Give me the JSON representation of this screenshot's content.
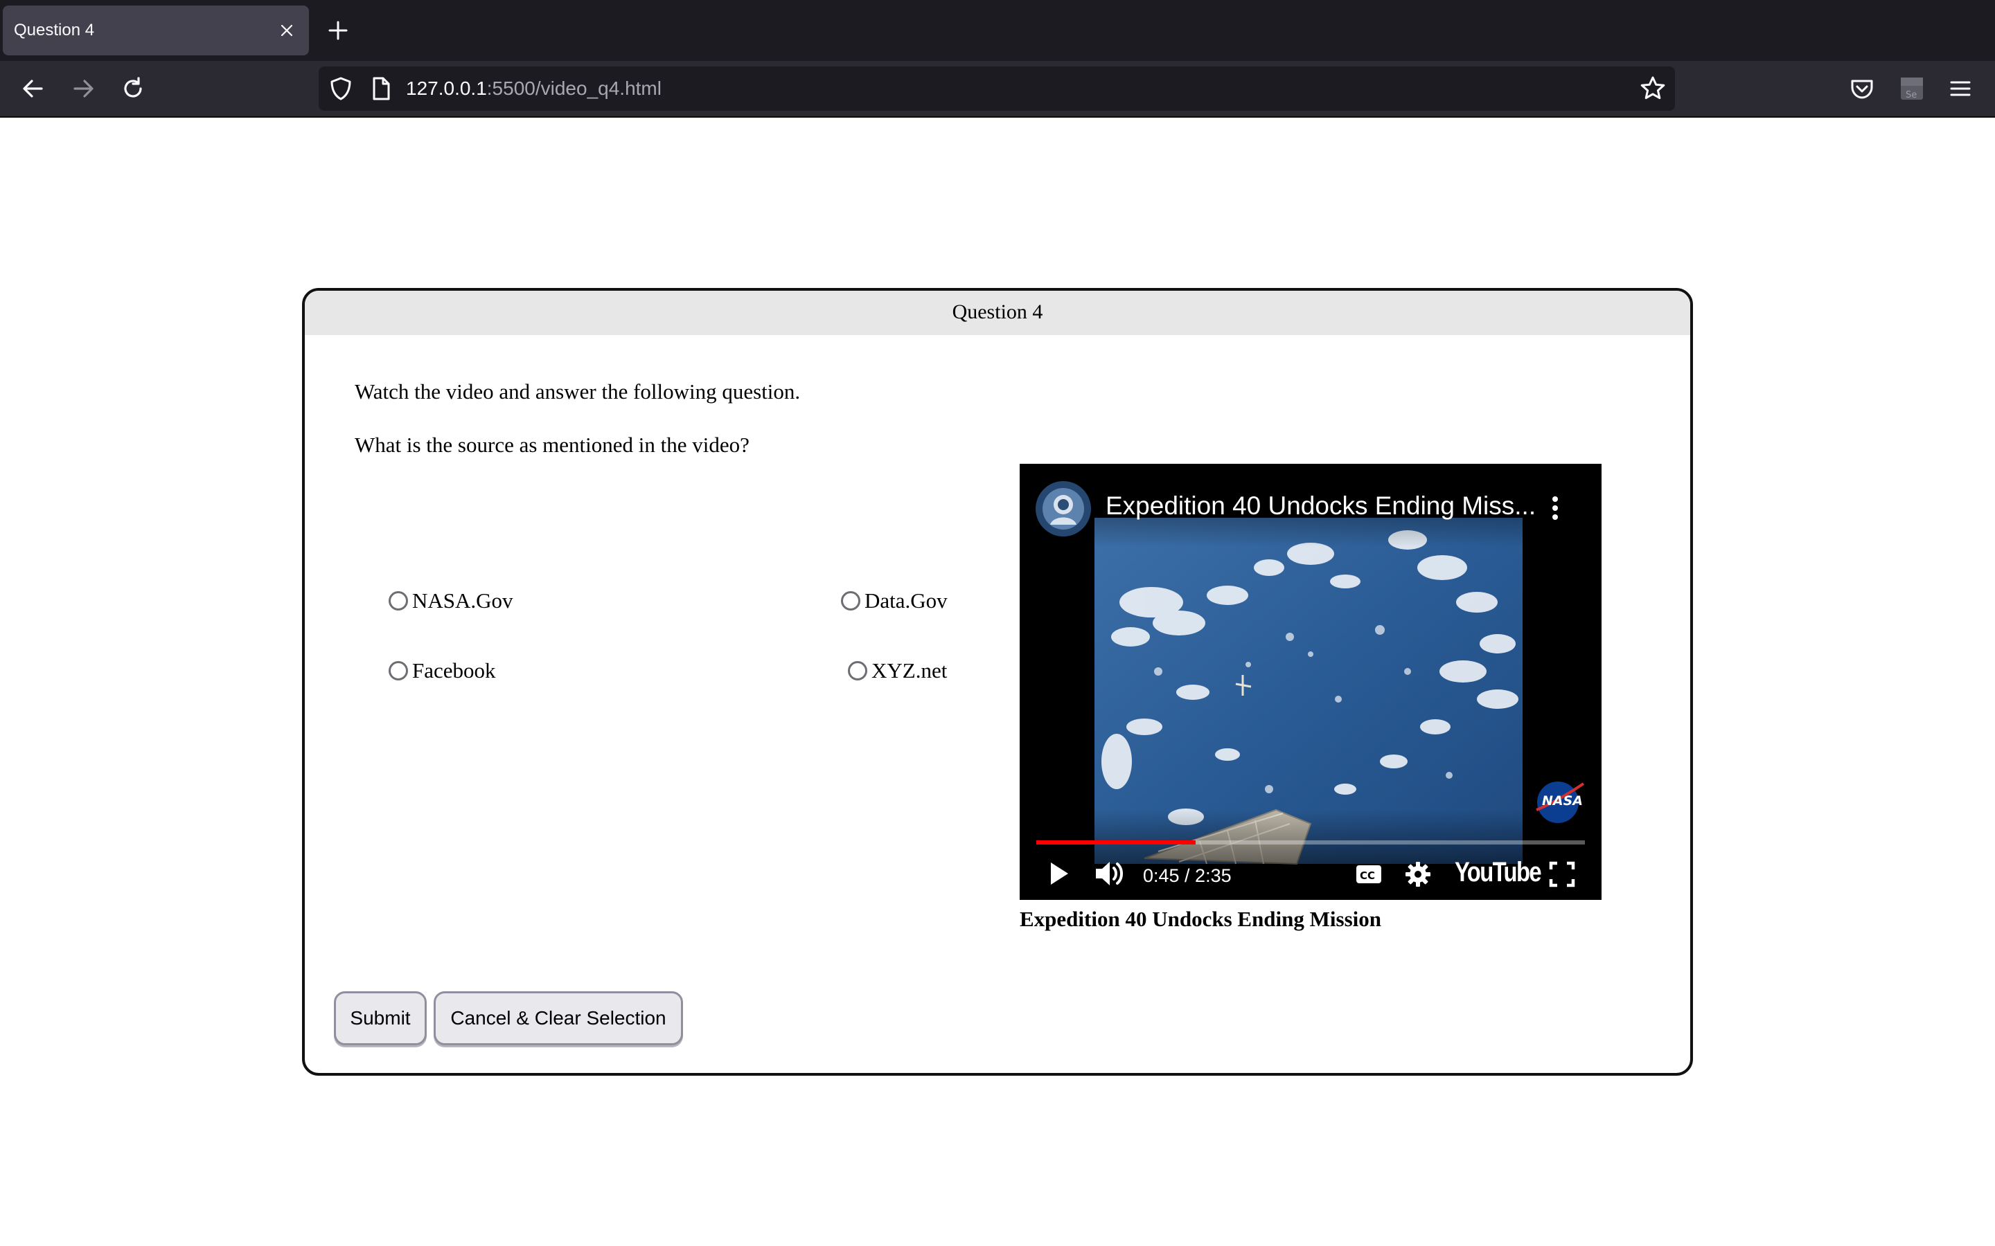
{
  "browser": {
    "tab_title": "Question 4",
    "url_host": "127.0.0.1",
    "url_rest": ":5500/video_q4.html"
  },
  "question": {
    "header": "Question 4",
    "instruction": "Watch the video and answer the following question.",
    "prompt": "What is the source as mentioned in the video?",
    "options": [
      {
        "label": "NASA.Gov",
        "selected": false
      },
      {
        "label": "Data.Gov",
        "selected": false
      },
      {
        "label": "Facebook",
        "selected": false
      },
      {
        "label": "XYZ.net",
        "selected": false
      }
    ]
  },
  "video": {
    "title": "Expedition 40 Undocks Ending Miss...",
    "time": "0:45 / 2:35",
    "progress": 0.29,
    "brand": "YouTube",
    "watermark": "NASA",
    "caption": "Expedition 40 Undocks Ending Mission",
    "progress_color": "#ff0000"
  },
  "buttons": {
    "submit": "Submit",
    "cancel": "Cancel & Clear Selection"
  },
  "icons": [
    "shield-icon",
    "page-icon",
    "star-icon",
    "back-icon",
    "forward-icon",
    "reload-icon",
    "pocket-icon",
    "extension-icon",
    "menu-icon",
    "close-icon",
    "plus-icon",
    "play-icon",
    "volume-icon",
    "cc-icon",
    "settings-icon",
    "fullscreen-icon",
    "kebab-menu-icon"
  ]
}
